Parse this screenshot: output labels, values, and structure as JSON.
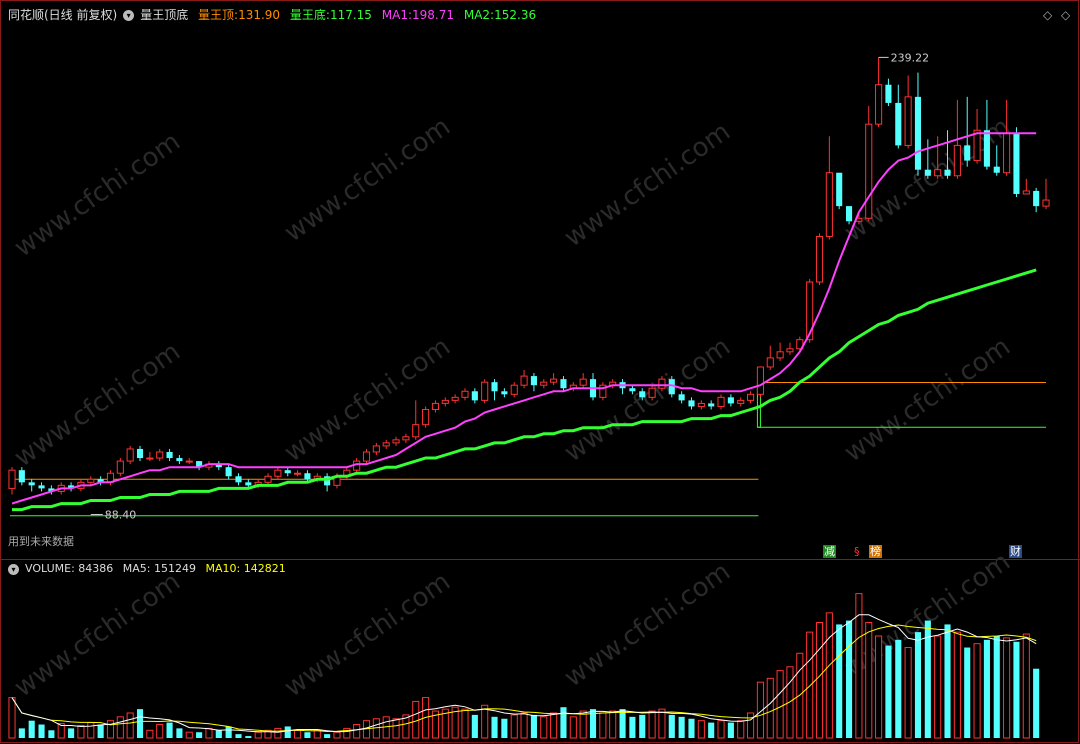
{
  "header": {
    "title": "同花顺(日线 前复权)",
    "indicator_name": "量王顶底",
    "top_label": "量王顶:",
    "top_value": "131.90",
    "bottom_label": "量王底:",
    "bottom_value": "117.15",
    "ma1_label": "MA1:",
    "ma1_value": "198.71",
    "ma2_label": "MA2:",
    "ma2_value": "152.36"
  },
  "annotations": {
    "high_label": "239.22",
    "low_label": "88.40",
    "future_text": "用到未来数据",
    "badge_1": "减",
    "badge_2": "§",
    "badge_3": "榜",
    "badge_4": "财"
  },
  "volume_header": {
    "volume_label": "VOLUME:",
    "volume_value": "84386",
    "ma5_label": "MA5:",
    "ma5_value": "151249",
    "ma10_label": "MA10:",
    "ma10_value": "142821"
  },
  "watermark": "www.cfchi.com",
  "colors": {
    "up": "#ff3232",
    "down": "#54ffff",
    "ma1": "#ff40ff",
    "ma2": "#33ff33",
    "top_line": "#ff8c00",
    "bottom_line": "#33ff33",
    "ma5_vol": "#ffffff",
    "ma10_vol": "#ffff00"
  },
  "chart_data": {
    "type": "candlestick",
    "ylim": [
      80,
      250
    ],
    "high_mark": 239.22,
    "low_mark": 88.4,
    "levels_early": {
      "top": 100.0,
      "bottom": 88.0
    },
    "levels_late": {
      "top": 131.9,
      "bottom": 117.15
    },
    "candles": [
      [
        97,
        103,
        95,
        104
      ],
      [
        103,
        99,
        98,
        104
      ],
      [
        99,
        98,
        96,
        100
      ],
      [
        98,
        97,
        96,
        99
      ],
      [
        97,
        96,
        95,
        98
      ],
      [
        96,
        98,
        95,
        99
      ],
      [
        98,
        97,
        96,
        99
      ],
      [
        97,
        99,
        96,
        100
      ],
      [
        99,
        100,
        98,
        101
      ],
      [
        100,
        99,
        98,
        101
      ],
      [
        99,
        102,
        98,
        103
      ],
      [
        102,
        106,
        101,
        107
      ],
      [
        106,
        110,
        105,
        111
      ],
      [
        110,
        107,
        106,
        111
      ],
      [
        107,
        107,
        106,
        109
      ],
      [
        107,
        109,
        106,
        110
      ],
      [
        109,
        107,
        106,
        110
      ],
      [
        107,
        106,
        105,
        108
      ],
      [
        106,
        106,
        105,
        107
      ],
      [
        106,
        104,
        103,
        106
      ],
      [
        104,
        105,
        103,
        106
      ],
      [
        105,
        104,
        103,
        106
      ],
      [
        104,
        101,
        100,
        105
      ],
      [
        101,
        99,
        98,
        102
      ],
      [
        99,
        98,
        97,
        100
      ],
      [
        98,
        99,
        97,
        100
      ],
      [
        99,
        101,
        98,
        102
      ],
      [
        101,
        103,
        100,
        104
      ],
      [
        103,
        102,
        101,
        104
      ],
      [
        102,
        102,
        101,
        103
      ],
      [
        102,
        100,
        99,
        103
      ],
      [
        100,
        101,
        99,
        102
      ],
      [
        101,
        98,
        96,
        102
      ],
      [
        98,
        101,
        97,
        102
      ],
      [
        101,
        103,
        100,
        104
      ],
      [
        103,
        106,
        102,
        107
      ],
      [
        106,
        109,
        105,
        110
      ],
      [
        109,
        111,
        108,
        112
      ],
      [
        111,
        112,
        110,
        113
      ],
      [
        112,
        113,
        111,
        114
      ],
      [
        113,
        114,
        112,
        115
      ],
      [
        114,
        118,
        113,
        126
      ],
      [
        118,
        123,
        117,
        124
      ],
      [
        123,
        125,
        122,
        126
      ],
      [
        125,
        126,
        124,
        127
      ],
      [
        126,
        127,
        125,
        128
      ],
      [
        127,
        129,
        126,
        130
      ],
      [
        129,
        126,
        125,
        130
      ],
      [
        126,
        132,
        125,
        133
      ],
      [
        132,
        129,
        126,
        133
      ],
      [
        129,
        128,
        127,
        130
      ],
      [
        128,
        131,
        127,
        132
      ],
      [
        131,
        134,
        130,
        136
      ],
      [
        134,
        131,
        129,
        135
      ],
      [
        131,
        132,
        130,
        133
      ],
      [
        132,
        133,
        131,
        135
      ],
      [
        133,
        130,
        129,
        134
      ],
      [
        130,
        131,
        129,
        132
      ],
      [
        131,
        133,
        130,
        135
      ],
      [
        133,
        127,
        126,
        135
      ],
      [
        127,
        131,
        126,
        132
      ],
      [
        131,
        132,
        130,
        133
      ],
      [
        132,
        130,
        128,
        133
      ],
      [
        130,
        129,
        128,
        131
      ],
      [
        129,
        127,
        126,
        130
      ],
      [
        127,
        130,
        126,
        131
      ],
      [
        130,
        133,
        129,
        134
      ],
      [
        133,
        128,
        127,
        134
      ],
      [
        128,
        126,
        125,
        129
      ],
      [
        126,
        124,
        123,
        127
      ],
      [
        124,
        125,
        123,
        126
      ],
      [
        125,
        124,
        123,
        126
      ],
      [
        124,
        127,
        123,
        128
      ],
      [
        127,
        125,
        124,
        128
      ],
      [
        125,
        126,
        124,
        127
      ],
      [
        126,
        128,
        125,
        129
      ],
      [
        128,
        137,
        127,
        137
      ],
      [
        137,
        140,
        136,
        144
      ],
      [
        140,
        142,
        139,
        145
      ],
      [
        142,
        143,
        141,
        145
      ],
      [
        143,
        146,
        142,
        147
      ],
      [
        146,
        165,
        145,
        166
      ],
      [
        165,
        180,
        164,
        181
      ],
      [
        180,
        201,
        179,
        213
      ],
      [
        201,
        190,
        189,
        194
      ],
      [
        190,
        185,
        184,
        187
      ],
      [
        185,
        186,
        184,
        188
      ],
      [
        186,
        217,
        185,
        223
      ],
      [
        217,
        230,
        216,
        239
      ],
      [
        230,
        224,
        223,
        232
      ],
      [
        224,
        210,
        209,
        230
      ],
      [
        210,
        226,
        209,
        233
      ],
      [
        226,
        202,
        200,
        234
      ],
      [
        202,
        200,
        199,
        212
      ],
      [
        200,
        202,
        199,
        213
      ],
      [
        202,
        200,
        199,
        215
      ],
      [
        200,
        210,
        199,
        225
      ],
      [
        210,
        205,
        203,
        226
      ],
      [
        205,
        215,
        204,
        222
      ],
      [
        215,
        203,
        202,
        225
      ],
      [
        203,
        201,
        200,
        210
      ],
      [
        201,
        214,
        200,
        225
      ],
      [
        214,
        194,
        193,
        216
      ],
      [
        194,
        195,
        194,
        199
      ],
      [
        195,
        190,
        188,
        196
      ],
      [
        190,
        192,
        189,
        199
      ]
    ],
    "ma1": [
      92,
      93,
      94,
      95,
      96,
      97,
      97,
      98,
      98,
      99,
      99,
      100,
      101,
      102,
      103,
      103,
      104,
      104,
      104,
      104,
      105,
      105,
      105,
      104,
      104,
      104,
      104,
      104,
      104,
      104,
      104,
      104,
      104,
      104,
      104,
      105,
      105,
      106,
      107,
      108,
      110,
      112,
      114,
      115,
      116,
      117,
      119,
      120,
      122,
      123,
      124,
      125,
      126,
      127,
      128,
      129,
      129,
      130,
      130,
      130,
      130,
      131,
      131,
      131,
      131,
      131,
      131,
      131,
      130,
      130,
      129,
      129,
      129,
      129,
      129,
      130,
      131,
      133,
      135,
      138,
      142,
      148,
      155,
      163,
      172,
      180,
      188,
      193,
      198,
      202,
      205,
      206,
      208,
      209,
      210,
      211,
      212,
      213,
      214,
      214,
      214,
      214,
      214,
      214,
      214
    ],
    "ma2": [
      90,
      90,
      91,
      91,
      91,
      92,
      92,
      92,
      93,
      93,
      93,
      94,
      94,
      94,
      95,
      95,
      95,
      96,
      96,
      96,
      96,
      97,
      97,
      97,
      97,
      98,
      98,
      98,
      99,
      99,
      99,
      100,
      100,
      101,
      101,
      102,
      102,
      103,
      104,
      104,
      105,
      106,
      107,
      107,
      108,
      109,
      110,
      110,
      111,
      112,
      112,
      113,
      114,
      114,
      115,
      115,
      116,
      116,
      117,
      117,
      117,
      118,
      118,
      118,
      119,
      119,
      119,
      119,
      119,
      120,
      120,
      120,
      121,
      121,
      122,
      123,
      124,
      126,
      127,
      129,
      132,
      134,
      137,
      140,
      142,
      145,
      147,
      149,
      151,
      152,
      154,
      155,
      156,
      158,
      159,
      160,
      161,
      162,
      163,
      164,
      165,
      166,
      167,
      168,
      169
    ],
    "volume": [
      72,
      40,
      48,
      44,
      38,
      45,
      40,
      43,
      46,
      44,
      48,
      52,
      56,
      60,
      38,
      44,
      46,
      40,
      36,
      36,
      40,
      38,
      42,
      34,
      32,
      36,
      38,
      40,
      42,
      38,
      36,
      38,
      34,
      36,
      40,
      44,
      48,
      50,
      52,
      50,
      54,
      68,
      72,
      58,
      60,
      62,
      60,
      54,
      64,
      52,
      50,
      54,
      56,
      54,
      52,
      56,
      62,
      52,
      58,
      60,
      56,
      58,
      60,
      52,
      54,
      58,
      60,
      54,
      52,
      50,
      48,
      46,
      48,
      46,
      48,
      56,
      88,
      92,
      100,
      104,
      118,
      140,
      150,
      160,
      148,
      152,
      180,
      150,
      136,
      126,
      132,
      124,
      140,
      152,
      136,
      148,
      140,
      124,
      128,
      132,
      136,
      134,
      130,
      138,
      102
    ],
    "vol_ylim": [
      30,
      190
    ]
  }
}
